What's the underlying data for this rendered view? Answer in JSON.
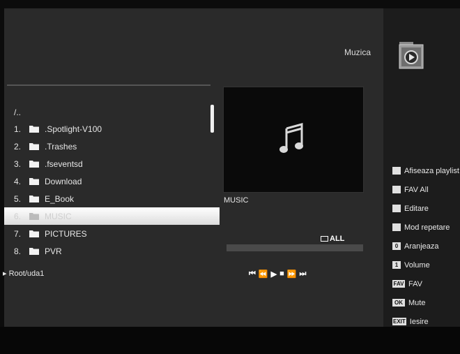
{
  "header": {
    "title": "Muzica",
    "icon": "music-folder-icon"
  },
  "file_list": {
    "parent_entry": "/..",
    "items": [
      {
        "num": "1.",
        "name": ".Spotlight-V100"
      },
      {
        "num": "2.",
        "name": ".Trashes"
      },
      {
        "num": "3.",
        "name": ".fseventsd"
      },
      {
        "num": "4.",
        "name": "Download"
      },
      {
        "num": "5.",
        "name": "E_Book"
      },
      {
        "num": "6.",
        "name": "MUSIC",
        "selected": true
      },
      {
        "num": "7.",
        "name": "PICTURES"
      },
      {
        "num": "8.",
        "name": "PVR"
      }
    ],
    "scroll_position": 0.12
  },
  "path": "Root/uda1",
  "preview": {
    "label": "MUSIC",
    "icon": "music-note-icon"
  },
  "playback": {
    "repeat_label": "ALL",
    "progress": 0.0,
    "controls": [
      {
        "name": "skip-back-icon",
        "glyph": "⏮"
      },
      {
        "name": "rewind-icon",
        "glyph": "⏪"
      },
      {
        "name": "play-icon",
        "glyph": "▶"
      },
      {
        "name": "stop-icon",
        "glyph": "■"
      },
      {
        "name": "fast-forward-icon",
        "glyph": "⏩"
      },
      {
        "name": "skip-forward-icon",
        "glyph": "⏭"
      }
    ]
  },
  "help": [
    {
      "key": "",
      "label": "Afiseaza playlist"
    },
    {
      "key": "",
      "label": "FAV All"
    },
    {
      "key": "",
      "label": "Editare"
    },
    {
      "key": "",
      "label": "Mod repetare"
    },
    {
      "key": "0",
      "label": "Aranjeaza"
    },
    {
      "key": "1",
      "label": "Volume"
    },
    {
      "key": "FAV",
      "label": "FAV"
    },
    {
      "key": "OK",
      "label": "Mute"
    },
    {
      "key": "EXIT",
      "label": "Iesire"
    }
  ]
}
